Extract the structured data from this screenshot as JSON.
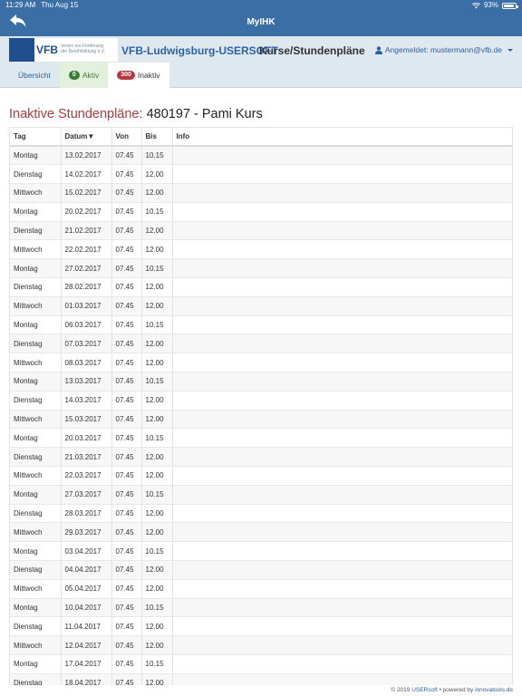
{
  "status": {
    "time": "11:29 AM",
    "date": "Thu Aug 15",
    "battery": "93%"
  },
  "app": {
    "title": "MyIHK"
  },
  "logo": {
    "mark": "VFB",
    "subtitle_line1": "Verein zur Förderung",
    "subtitle_line2": "der Berufsbildung e.V."
  },
  "header": {
    "org_name": "VFB-Ludwigsburg-USERSOFT",
    "page_name": "Kurse/Stundenpläne",
    "user_label": "Angemeldet: mustermann@vfb.de"
  },
  "tabs": {
    "overview": "Übersicht",
    "active_count": "0",
    "active_label": "Aktiv",
    "inactive_count": "300",
    "inactive_label": "Inaktiv"
  },
  "heading": {
    "prefix": "Inaktive Stundenpläne:",
    "course": "480197 - Pami Kurs"
  },
  "table": {
    "columns": [
      "Tag",
      "Datum▼",
      "Von",
      "Bis",
      "Info"
    ],
    "rows": [
      [
        "Montag",
        "13.02.2017",
        "07.45",
        "10.15",
        ""
      ],
      [
        "Dienstag",
        "14.02.2017",
        "07.45",
        "12.00",
        ""
      ],
      [
        "Mittwoch",
        "15.02.2017",
        "07.45",
        "12.00",
        ""
      ],
      [
        "Montag",
        "20.02.2017",
        "07.45",
        "10.15",
        ""
      ],
      [
        "Dienstag",
        "21.02.2017",
        "07.45",
        "12.00",
        ""
      ],
      [
        "Mittwoch",
        "22.02.2017",
        "07.45",
        "12.00",
        ""
      ],
      [
        "Montag",
        "27.02.2017",
        "07.45",
        "10.15",
        ""
      ],
      [
        "Dienstag",
        "28.02.2017",
        "07.45",
        "12.00",
        ""
      ],
      [
        "Mittwoch",
        "01.03.2017",
        "07.45",
        "12.00",
        ""
      ],
      [
        "Montag",
        "06.03.2017",
        "07.45",
        "10.15",
        ""
      ],
      [
        "Dienstag",
        "07.03.2017",
        "07.45",
        "12.00",
        ""
      ],
      [
        "Mittwoch",
        "08.03.2017",
        "07.45",
        "12.00",
        ""
      ],
      [
        "Montag",
        "13.03.2017",
        "07.45",
        "10.15",
        ""
      ],
      [
        "Dienstag",
        "14.03.2017",
        "07.45",
        "12.00",
        ""
      ],
      [
        "Mittwoch",
        "15.03.2017",
        "07.45",
        "12.00",
        ""
      ],
      [
        "Montag",
        "20.03.2017",
        "07.45",
        "10.15",
        ""
      ],
      [
        "Dienstag",
        "21.03.2017",
        "07.45",
        "12.00",
        ""
      ],
      [
        "Mittwoch",
        "22.03.2017",
        "07.45",
        "12.00",
        ""
      ],
      [
        "Montag",
        "27.03.2017",
        "07.45",
        "10.15",
        ""
      ],
      [
        "Dienstag",
        "28.03.2017",
        "07.45",
        "12.00",
        ""
      ],
      [
        "Mittwoch",
        "29.03.2017",
        "07.45",
        "12.00",
        ""
      ],
      [
        "Montag",
        "03.04.2017",
        "07.45",
        "10.15",
        ""
      ],
      [
        "Dienstag",
        "04.04.2017",
        "07.45",
        "12.00",
        ""
      ],
      [
        "Mittwoch",
        "05.04.2017",
        "07.45",
        "12.00",
        ""
      ],
      [
        "Montag",
        "10.04.2017",
        "07.45",
        "10.15",
        ""
      ],
      [
        "Dienstag",
        "11.04.2017",
        "07.45",
        "12.00",
        ""
      ],
      [
        "Mittwoch",
        "12.04.2017",
        "07.45",
        "12.00",
        ""
      ],
      [
        "Montag",
        "17.04.2017",
        "07.45",
        "10.15",
        ""
      ],
      [
        "Dienstag",
        "18.04.2017",
        "07.45",
        "12.00",
        ""
      ]
    ]
  },
  "footer": {
    "prefix": "© 2019",
    "usersoft": "USERsoft",
    "middle": "•  powered by",
    "innova": "innovatools.de"
  }
}
